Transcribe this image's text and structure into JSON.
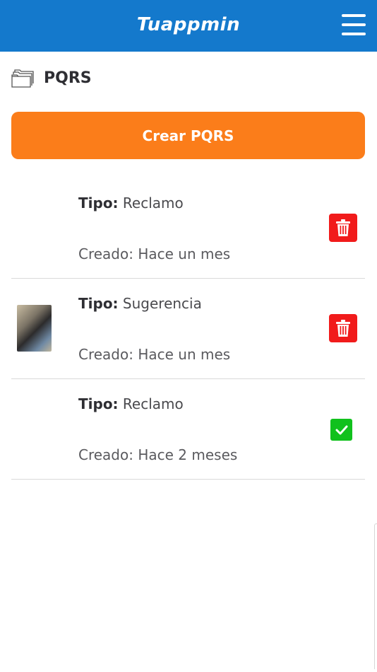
{
  "app": {
    "title": "Tuappmin"
  },
  "header": {
    "menu_icon": "hamburger-menu-icon"
  },
  "section": {
    "icon": "folder-icon",
    "title": "PQRS"
  },
  "create_button": {
    "label": "Crear PQRS"
  },
  "pqrs_items": [
    {
      "type_label": "Tipo:",
      "type_value": "Reclamo",
      "created": "Creado: Hace un mes",
      "has_thumbnail": false,
      "action": "delete",
      "action_icon": "trash-icon"
    },
    {
      "type_label": "Tipo:",
      "type_value": "Sugerencia",
      "created": "Creado: Hace un mes",
      "has_thumbnail": true,
      "action": "delete",
      "action_icon": "trash-icon"
    },
    {
      "type_label": "Tipo:",
      "type_value": "Reclamo",
      "created": "Creado: Hace 2 meses",
      "has_thumbnail": false,
      "action": "resolved",
      "action_icon": "checkmark-icon"
    }
  ],
  "colors": {
    "header_bg": "#1479cc",
    "create_button_bg": "#fb7d1a",
    "delete_bg": "#f11b1b",
    "check_bg": "#11c11d"
  }
}
